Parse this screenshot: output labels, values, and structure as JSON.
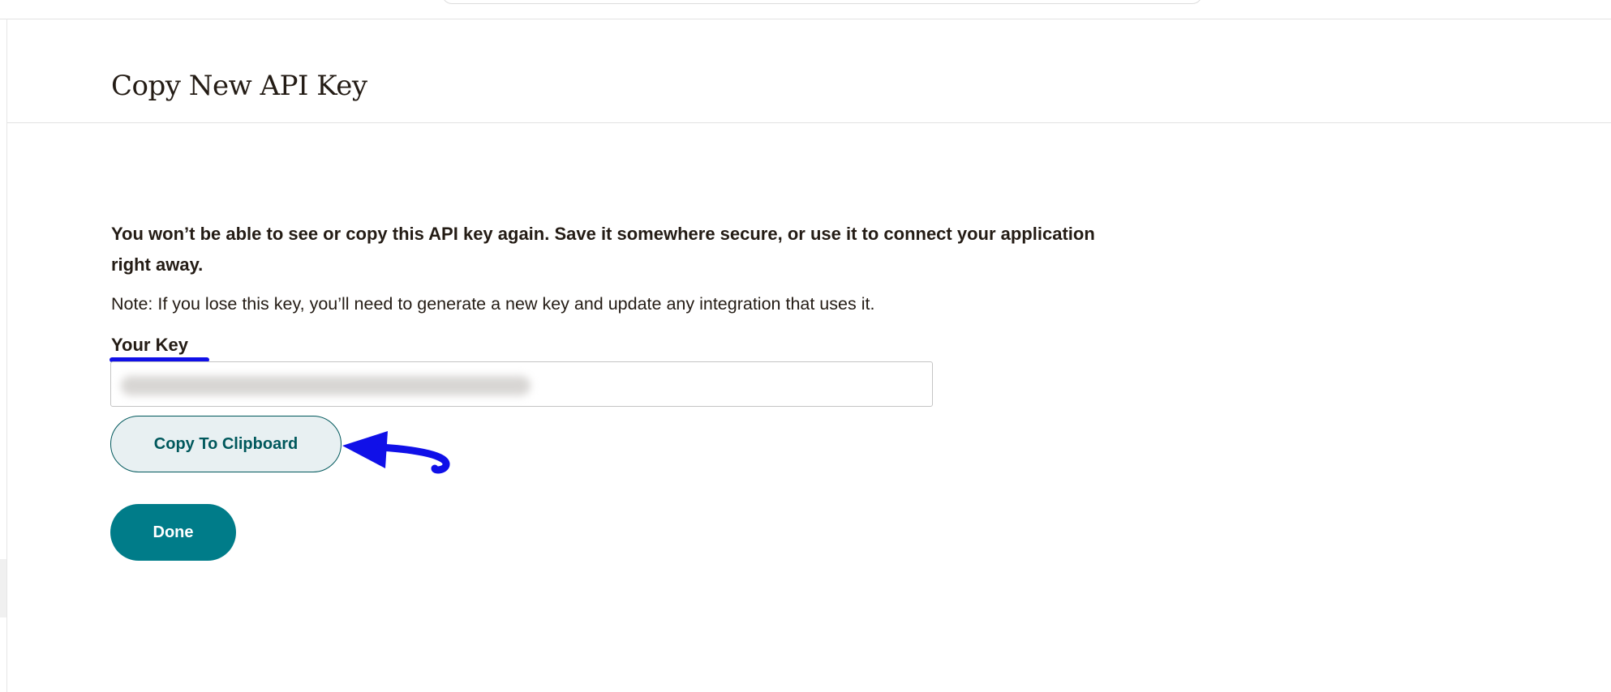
{
  "dialog": {
    "title": "Copy New API Key",
    "warning": "You won’t be able to see or copy this API key again. Save it somewhere secure, or use it to connect your application right away.",
    "note": "Note: If you lose this key, you’ll need to generate a new key and update any integration that uses it.",
    "key_label": "Your Key",
    "copy_button": "Copy To Clipboard",
    "done_button": "Done"
  },
  "colors": {
    "primary": "#007c89",
    "annotation": "#1010e8"
  }
}
